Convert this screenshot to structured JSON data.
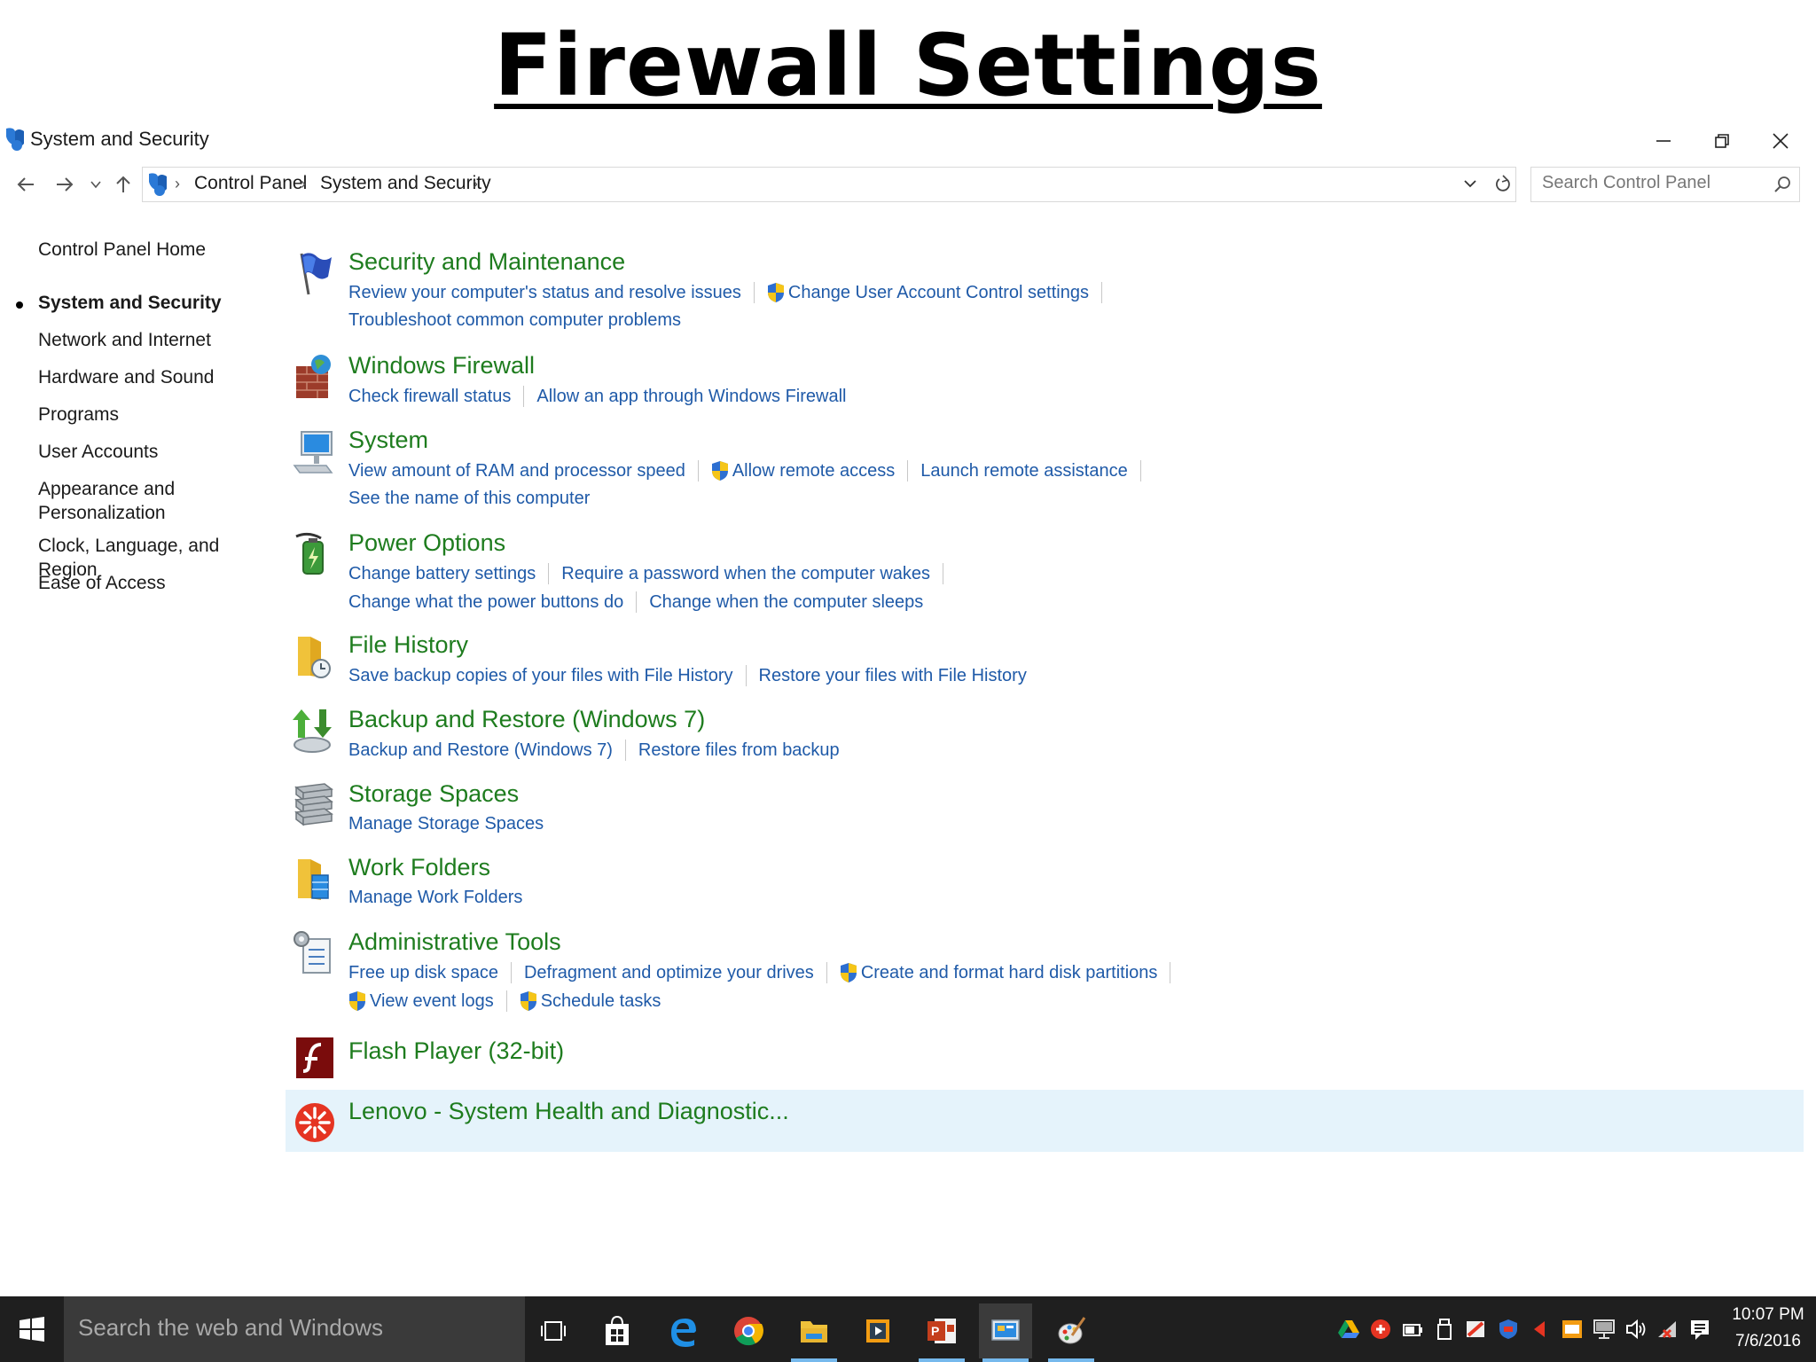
{
  "slide_title": "Firewall Settings",
  "window": {
    "title": "System and Security"
  },
  "address_bar": {
    "breadcrumbs": [
      "Control Panel",
      "System and Security"
    ]
  },
  "search": {
    "placeholder": "Search Control Panel"
  },
  "left_nav": {
    "items": [
      {
        "label": "Control Panel Home"
      },
      {
        "label": "System and Security",
        "active": true
      },
      {
        "label": "Network and Internet"
      },
      {
        "label": "Hardware and Sound"
      },
      {
        "label": "Programs"
      },
      {
        "label": "User Accounts"
      },
      {
        "label": "Appearance and Personalization"
      },
      {
        "label": "Clock, Language, and Region"
      },
      {
        "label": "Ease of Access"
      }
    ]
  },
  "categories": [
    {
      "title": "Security and Maintenance",
      "icon": "flag-icon",
      "links": [
        "Review your computer's status and resolve issues",
        "Change User Account Control settings",
        "Troubleshoot common computer problems"
      ]
    },
    {
      "title": "Windows Firewall",
      "icon": "firewall-icon",
      "links": [
        "Check firewall status",
        "Allow an app through Windows Firewall"
      ]
    },
    {
      "title": "System",
      "icon": "computer-icon",
      "links": [
        "View amount of RAM and processor speed",
        "Allow remote access",
        "Launch remote assistance",
        "See the name of this computer"
      ]
    },
    {
      "title": "Power Options",
      "icon": "battery-icon",
      "links": [
        "Change battery settings",
        "Require a password when the computer wakes",
        "Change what the power buttons do",
        "Change when the computer sleeps"
      ]
    },
    {
      "title": "File History",
      "icon": "file-history-icon",
      "links": [
        "Save backup copies of your files with File History",
        "Restore your files with File History"
      ]
    },
    {
      "title": "Backup and Restore (Windows 7)",
      "icon": "backup-icon",
      "links": [
        "Backup and Restore (Windows 7)",
        "Restore files from backup"
      ]
    },
    {
      "title": "Storage Spaces",
      "icon": "storage-icon",
      "links": [
        "Manage Storage Spaces"
      ]
    },
    {
      "title": "Work Folders",
      "icon": "work-folders-icon",
      "links": [
        "Manage Work Folders"
      ]
    },
    {
      "title": "Administrative Tools",
      "icon": "admin-tools-icon",
      "links": [
        "Free up disk space",
        "Defragment and optimize your drives",
        "Create and format hard disk partitions",
        "View event logs",
        "Schedule tasks"
      ]
    },
    {
      "title": "Flash Player (32-bit)",
      "icon": "flash-icon",
      "links": []
    },
    {
      "title": "Lenovo - System Health and Diagnostic...",
      "icon": "lenovo-icon",
      "links": []
    }
  ],
  "taskbar": {
    "search_placeholder": "Search the web and Windows",
    "apps": [
      "task-view-icon",
      "store-icon",
      "edge-icon",
      "chrome-icon",
      "file-explorer-icon",
      "media-player-icon",
      "powerpoint-icon",
      "control-panel-icon",
      "paint-icon"
    ],
    "clock_time": "10:07 PM",
    "clock_date": "7/6/2016"
  },
  "colors": {
    "category_title": "#1e7c1e",
    "link": "#1f5aa8",
    "taskbar": "#1f1f1f",
    "highlight": "#e5f3fb"
  }
}
